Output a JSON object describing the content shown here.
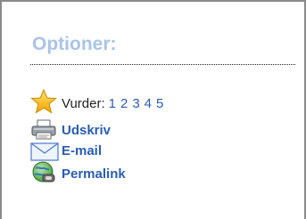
{
  "options": {
    "title": "Optioner:",
    "rate": {
      "label": "Vurder:",
      "values": [
        "1",
        "2",
        "3",
        "4",
        "5"
      ],
      "icon": "star-icon"
    },
    "actions": [
      {
        "label": "Udskriv",
        "icon": "printer-icon"
      },
      {
        "label": "E-mail",
        "icon": "envelope-icon"
      },
      {
        "label": "Permalink",
        "icon": "globe-link-icon"
      }
    ]
  },
  "colors": {
    "title": "#a9c4e6",
    "link": "#2a5db0",
    "text": "#222222",
    "border": "#8a8a8a"
  }
}
